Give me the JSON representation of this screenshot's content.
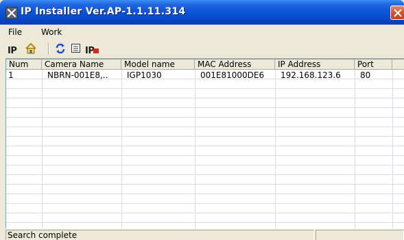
{
  "window": {
    "title": "IP Installer Ver.AP-1.1.11.314",
    "accent_color": "#0a54d8",
    "close_color": "#d9512c"
  },
  "menu": [
    "File",
    "Work"
  ],
  "toolbar": {
    "icons": [
      "ip-icon",
      "home-icon",
      "refresh-icon",
      "list-icon",
      "ip-red-icon"
    ],
    "ip_label": "IP",
    "ip_red_label": "IP"
  },
  "table": {
    "columns": [
      "Num",
      "Camera Name",
      "Model name",
      "MAC Address",
      "IP Address",
      "Port"
    ],
    "rows": [
      [
        "1",
        "NBRN-001E8,..",
        "IGP1030",
        "001E81000DE6",
        "192.168.123.6",
        "80"
      ]
    ]
  },
  "status": {
    "text": "Search complete"
  }
}
